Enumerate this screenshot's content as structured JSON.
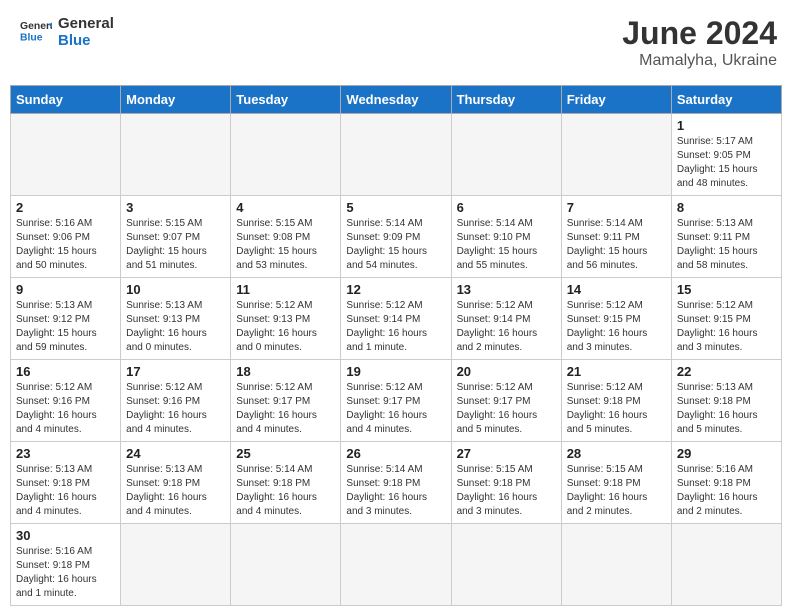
{
  "header": {
    "logo_general": "General",
    "logo_blue": "Blue",
    "month_year": "June 2024",
    "location": "Mamalyha, Ukraine"
  },
  "days_of_week": [
    "Sunday",
    "Monday",
    "Tuesday",
    "Wednesday",
    "Thursday",
    "Friday",
    "Saturday"
  ],
  "weeks": [
    [
      {
        "day": "",
        "info": ""
      },
      {
        "day": "",
        "info": ""
      },
      {
        "day": "",
        "info": ""
      },
      {
        "day": "",
        "info": ""
      },
      {
        "day": "",
        "info": ""
      },
      {
        "day": "",
        "info": ""
      },
      {
        "day": "1",
        "info": "Sunrise: 5:17 AM\nSunset: 9:05 PM\nDaylight: 15 hours and 48 minutes."
      }
    ],
    [
      {
        "day": "2",
        "info": "Sunrise: 5:16 AM\nSunset: 9:06 PM\nDaylight: 15 hours and 50 minutes."
      },
      {
        "day": "3",
        "info": "Sunrise: 5:15 AM\nSunset: 9:07 PM\nDaylight: 15 hours and 51 minutes."
      },
      {
        "day": "4",
        "info": "Sunrise: 5:15 AM\nSunset: 9:08 PM\nDaylight: 15 hours and 53 minutes."
      },
      {
        "day": "5",
        "info": "Sunrise: 5:14 AM\nSunset: 9:09 PM\nDaylight: 15 hours and 54 minutes."
      },
      {
        "day": "6",
        "info": "Sunrise: 5:14 AM\nSunset: 9:10 PM\nDaylight: 15 hours and 55 minutes."
      },
      {
        "day": "7",
        "info": "Sunrise: 5:14 AM\nSunset: 9:11 PM\nDaylight: 15 hours and 56 minutes."
      },
      {
        "day": "8",
        "info": "Sunrise: 5:13 AM\nSunset: 9:11 PM\nDaylight: 15 hours and 58 minutes."
      }
    ],
    [
      {
        "day": "9",
        "info": "Sunrise: 5:13 AM\nSunset: 9:12 PM\nDaylight: 15 hours and 59 minutes."
      },
      {
        "day": "10",
        "info": "Sunrise: 5:13 AM\nSunset: 9:13 PM\nDaylight: 16 hours and 0 minutes."
      },
      {
        "day": "11",
        "info": "Sunrise: 5:12 AM\nSunset: 9:13 PM\nDaylight: 16 hours and 0 minutes."
      },
      {
        "day": "12",
        "info": "Sunrise: 5:12 AM\nSunset: 9:14 PM\nDaylight: 16 hours and 1 minute."
      },
      {
        "day": "13",
        "info": "Sunrise: 5:12 AM\nSunset: 9:14 PM\nDaylight: 16 hours and 2 minutes."
      },
      {
        "day": "14",
        "info": "Sunrise: 5:12 AM\nSunset: 9:15 PM\nDaylight: 16 hours and 3 minutes."
      },
      {
        "day": "15",
        "info": "Sunrise: 5:12 AM\nSunset: 9:15 PM\nDaylight: 16 hours and 3 minutes."
      }
    ],
    [
      {
        "day": "16",
        "info": "Sunrise: 5:12 AM\nSunset: 9:16 PM\nDaylight: 16 hours and 4 minutes."
      },
      {
        "day": "17",
        "info": "Sunrise: 5:12 AM\nSunset: 9:16 PM\nDaylight: 16 hours and 4 minutes."
      },
      {
        "day": "18",
        "info": "Sunrise: 5:12 AM\nSunset: 9:17 PM\nDaylight: 16 hours and 4 minutes."
      },
      {
        "day": "19",
        "info": "Sunrise: 5:12 AM\nSunset: 9:17 PM\nDaylight: 16 hours and 4 minutes."
      },
      {
        "day": "20",
        "info": "Sunrise: 5:12 AM\nSunset: 9:17 PM\nDaylight: 16 hours and 5 minutes."
      },
      {
        "day": "21",
        "info": "Sunrise: 5:12 AM\nSunset: 9:18 PM\nDaylight: 16 hours and 5 minutes."
      },
      {
        "day": "22",
        "info": "Sunrise: 5:13 AM\nSunset: 9:18 PM\nDaylight: 16 hours and 5 minutes."
      }
    ],
    [
      {
        "day": "23",
        "info": "Sunrise: 5:13 AM\nSunset: 9:18 PM\nDaylight: 16 hours and 4 minutes."
      },
      {
        "day": "24",
        "info": "Sunrise: 5:13 AM\nSunset: 9:18 PM\nDaylight: 16 hours and 4 minutes."
      },
      {
        "day": "25",
        "info": "Sunrise: 5:14 AM\nSunset: 9:18 PM\nDaylight: 16 hours and 4 minutes."
      },
      {
        "day": "26",
        "info": "Sunrise: 5:14 AM\nSunset: 9:18 PM\nDaylight: 16 hours and 3 minutes."
      },
      {
        "day": "27",
        "info": "Sunrise: 5:15 AM\nSunset: 9:18 PM\nDaylight: 16 hours and 3 minutes."
      },
      {
        "day": "28",
        "info": "Sunrise: 5:15 AM\nSunset: 9:18 PM\nDaylight: 16 hours and 2 minutes."
      },
      {
        "day": "29",
        "info": "Sunrise: 5:16 AM\nSunset: 9:18 PM\nDaylight: 16 hours and 2 minutes."
      }
    ],
    [
      {
        "day": "30",
        "info": "Sunrise: 5:16 AM\nSunset: 9:18 PM\nDaylight: 16 hours and 1 minute."
      },
      {
        "day": "",
        "info": ""
      },
      {
        "day": "",
        "info": ""
      },
      {
        "day": "",
        "info": ""
      },
      {
        "day": "",
        "info": ""
      },
      {
        "day": "",
        "info": ""
      },
      {
        "day": "",
        "info": ""
      }
    ]
  ]
}
